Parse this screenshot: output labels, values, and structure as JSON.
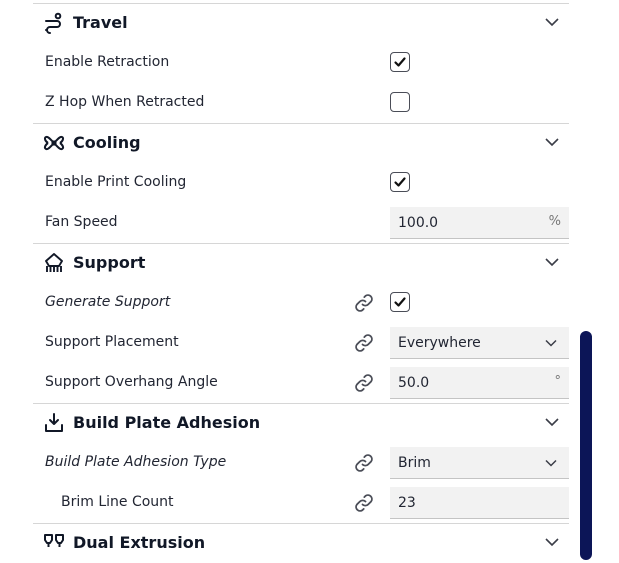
{
  "sections": {
    "travel": {
      "title": "Travel",
      "icon": "travel-icon",
      "rows": {
        "enable_retraction": {
          "label": "Enable Retraction",
          "checked": true
        },
        "z_hop": {
          "label": "Z Hop When Retracted",
          "checked": false
        }
      }
    },
    "cooling": {
      "title": "Cooling",
      "icon": "fan-icon",
      "rows": {
        "enable_print_cooling": {
          "label": "Enable Print Cooling",
          "checked": true
        },
        "fan_speed": {
          "label": "Fan Speed",
          "value": "100.0",
          "unit": "%"
        }
      }
    },
    "support": {
      "title": "Support",
      "icon": "support-icon",
      "rows": {
        "generate_support": {
          "label": "Generate Support",
          "checked": true
        },
        "support_placement": {
          "label": "Support Placement",
          "value": "Everywhere"
        },
        "support_overhang_angle": {
          "label": "Support Overhang Angle",
          "value": "50.0",
          "unit": "°"
        }
      }
    },
    "adhesion": {
      "title": "Build Plate Adhesion",
      "icon": "build-plate-adhesion-icon",
      "rows": {
        "adhesion_type": {
          "label": "Build Plate Adhesion Type",
          "value": "Brim"
        },
        "brim_line_count": {
          "label": "Brim Line Count",
          "value": "23"
        }
      }
    },
    "dual_extrusion": {
      "title": "Dual Extrusion",
      "icon": "dual-extrusion-icon"
    }
  },
  "colors": {
    "scrollbar_thumb": "#0c1557",
    "divider": "#d6d6d6",
    "field_bg": "#f2f2f2"
  }
}
